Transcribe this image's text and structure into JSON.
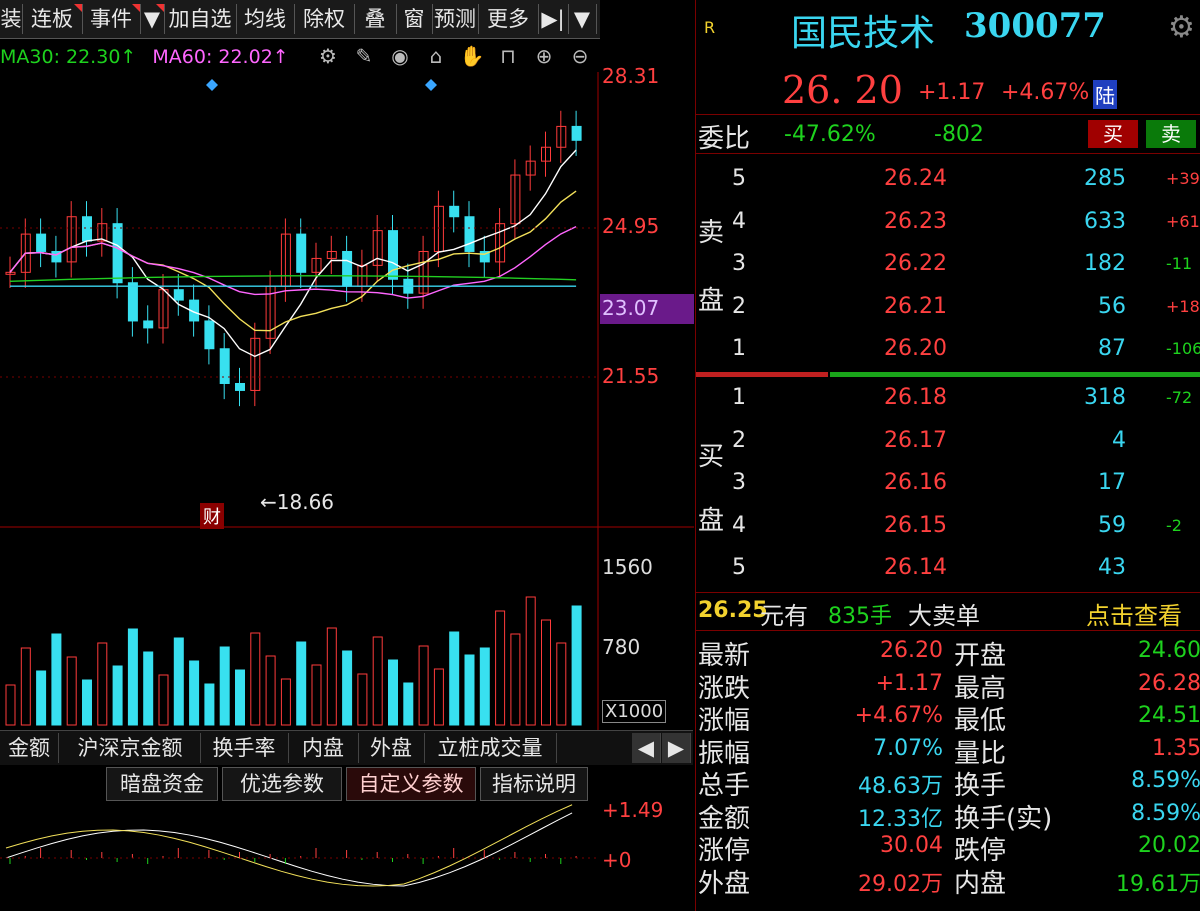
{
  "toolbar": {
    "items": [
      "装",
      "连板",
      "事件",
      "▼",
      "加自选",
      "均线",
      "除权",
      "叠",
      "窗",
      "预测",
      "更多",
      "▶|",
      "▼"
    ]
  },
  "ma_legend": {
    "ma30": "MA30: 22.30↑",
    "ma60": "MA60: 22.02↑"
  },
  "price_axis": {
    "p1": "28.31",
    "p2": "24.95",
    "p3": "23.07",
    "p4": "21.55"
  },
  "annotations": {
    "low_marker": "←18.66",
    "fin_badge": "财"
  },
  "volume_axis": {
    "v1": "1560",
    "v2": "780",
    "unit": "X1000"
  },
  "lower_tabs": [
    "金额",
    "沪深京金额",
    "换手率",
    "内盘",
    "外盘",
    "立桩成交量"
  ],
  "sub_tabs": [
    "暗盘资金",
    "优选参数",
    "自定义参数",
    "指标说明"
  ],
  "macd_axis": {
    "top": "+1.49",
    "zero": "+0"
  },
  "quote": {
    "r_badge": "R",
    "name": "国民技术",
    "code": "300077",
    "price": "26. 20",
    "change": "+1.17",
    "change_pct": "+4.67%",
    "market_badge": "陆",
    "weibi_label": "委比",
    "weibi_pct": "-47.62%",
    "weibi_diff": "-802",
    "buy_btn": "买",
    "sell_btn": "卖"
  },
  "sell_side_label": [
    "卖",
    "盘"
  ],
  "buy_side_label": [
    "买",
    "盘"
  ],
  "asks": [
    {
      "lvl": "5",
      "price": "26.24",
      "vol": "285",
      "chg": "+39"
    },
    {
      "lvl": "4",
      "price": "26.23",
      "vol": "633",
      "chg": "+61"
    },
    {
      "lvl": "3",
      "price": "26.22",
      "vol": "182",
      "chg": "-11"
    },
    {
      "lvl": "2",
      "price": "26.21",
      "vol": "56",
      "chg": "+18"
    },
    {
      "lvl": "1",
      "price": "26.20",
      "vol": "87",
      "chg": "-106"
    }
  ],
  "bids": [
    {
      "lvl": "1",
      "price": "26.18",
      "vol": "318",
      "chg": "-72"
    },
    {
      "lvl": "2",
      "price": "26.17",
      "vol": "4",
      "chg": ""
    },
    {
      "lvl": "3",
      "price": "26.16",
      "vol": "17",
      "chg": ""
    },
    {
      "lvl": "4",
      "price": "26.15",
      "vol": "59",
      "chg": "-2"
    },
    {
      "lvl": "5",
      "price": "26.14",
      "vol": "43",
      "chg": ""
    }
  ],
  "big_order": {
    "price": "26.25",
    "unit1": "元有",
    "qty": "835手",
    "desc": "大卖单",
    "link": "点击查看"
  },
  "stats": [
    {
      "l1": "最新",
      "v1": "26.20",
      "c1": "red",
      "l2": "开盘",
      "v2": "24.60",
      "c2": "green"
    },
    {
      "l1": "涨跌",
      "v1": "+1.17",
      "c1": "red",
      "l2": "最高",
      "v2": "26.28",
      "c2": "red"
    },
    {
      "l1": "涨幅",
      "v1": "+4.67%",
      "c1": "red",
      "l2": "最低",
      "v2": "24.51",
      "c2": "green"
    },
    {
      "l1": "振幅",
      "v1": "7.07%",
      "c1": "cyan",
      "l2": "量比",
      "v2": "1.35",
      "c2": "red"
    },
    {
      "l1": "总手",
      "v1": "48.63万",
      "c1": "cyan",
      "l2": "换手",
      "v2": "8.59%",
      "c2": "cyan"
    },
    {
      "l1": "金额",
      "v1": "12.33亿",
      "c1": "cyan",
      "l2": "换手(实)",
      "v2": "8.59%",
      "c2": "cyan"
    },
    {
      "l1": "涨停",
      "v1": "30.04",
      "c1": "red",
      "l2": "跌停",
      "v2": "20.02",
      "c2": "green"
    },
    {
      "l1": "外盘",
      "v1": "29.02万",
      "c1": "red",
      "l2": "内盘",
      "v2": "19.61万",
      "c2": "green"
    }
  ],
  "colors": {
    "up": "#ff3b3b",
    "down": "#38e0f0",
    "ma5": "#ffffff",
    "ma10": "#f2e05a",
    "ma20": "#ff66ff",
    "ma30": "#22d022",
    "ma60": "#3ad6f0"
  }
}
